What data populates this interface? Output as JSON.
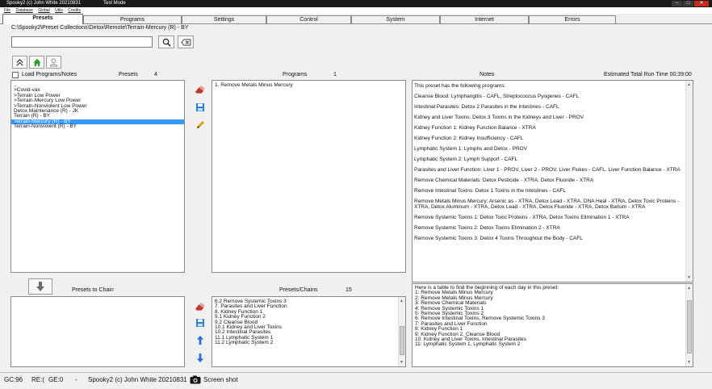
{
  "window": {
    "title": "Spooky2 (c) John White 20210831",
    "mode": "Test Mode"
  },
  "menu": [
    "File",
    "Database",
    "Global",
    "Utils",
    "Credits"
  ],
  "tabs": [
    "Presets",
    "Programs",
    "Settings",
    "Control",
    "System",
    "Internet",
    "Errors"
  ],
  "path": "C:\\Spooky2\\Preset Collections\\Detox\\Remote\\Terrain-Mercury (R) - BY",
  "search": {
    "value": "",
    "placeholder": ""
  },
  "presets": {
    "load_label": "Load Programs/Notes",
    "header": "Presets",
    "count": "4",
    "items": [
      "..",
      ">Covid-vax",
      ">Terrain Low Power",
      ">Terrain-Mercury Low Power",
      ">Terrain-Nonviolent Low Power",
      "Detox Maintenance (R) - JK",
      "Terrain (R) - BY",
      "Terrain-Mercury (R) - BY",
      "Terrain-Nonviolent (R) - BY"
    ],
    "selected_index": 7
  },
  "programs": {
    "header": "Programs",
    "count": "1",
    "items": [
      "1. Remove Metals Minus Mercury"
    ]
  },
  "notes": {
    "header": "Notes",
    "run_time": "Estimated Total Run Time 00:39:00",
    "paragraphs": [
      "This preset has the following programs:",
      "Cleanse Blood: Lymphangitis - CAFL, Streptococcus Pyogenes - CAFL",
      "Intestinal Parasites: Detox 2 Parasites in the Intestines - CAFL",
      "Kidney and Liver Toxins: Detox 3 Toxins in the Kidneys and Liver - PROV",
      "Kidney Function 1: Kidney Function Balance - XTRA",
      "Kidney Function 2: Kidney Insufficiency - CAFL",
      "Lymphatic System 1: Lymphs and Detox - PROV",
      "Lymphatic System 2: Lymph Support - CAFL",
      "Parasites and Liver Function: Liver 1 - PROV, Liver 2 - PROV, Liver Flukes - CAFL, Liver Function Balance - XTRA",
      "Remove Chemical Materials: Detox Pesticide - XTRA, Detox Fluoride - XTRA",
      "Remove Intestinal Toxins: Detox 1 Toxins in the Intestines - CAFL",
      "Remove Metals Minus Mercury: Arsenic as - XTRA, Detox Lead - XTRA, DNA Heal - XTRA, Detox Toxic Proteins - XTRA, Detox Aluminum - XTRA, Detox Lead - XTRA, Detox Fluoride - XTRA, Detox Barium - XTRA",
      "Remove Systemic Toxins 1: Detox Toxic Proteins - XTRA, Detox Toxins Elimination 1 - XTRA",
      "Remove Systemic Toxins 2: Detox Toxins Elimination 2 - XTRA",
      "Remove Systemic Toxins 3: Detox 4 Toxins Throughout the Body - CAFL"
    ]
  },
  "chain": {
    "label": "Presets to Chain",
    "items": []
  },
  "preset_chains": {
    "header": "Presets/Chains",
    "count": "15",
    "items": [
      "6.2 Remove Systemic Toxins 3",
      "7. Parasites and Liver Function",
      "8. Kidney Function 1",
      "9.1 Kidney Function 2",
      "9.2 Cleanse Blood",
      "10.1 Kidney and Liver Toxins",
      "10.2 Intestinal Parasites",
      "11.1 Lymphatic System 1",
      "11.2 Lymphatic System 2"
    ]
  },
  "chain_notes": {
    "lines": [
      "Here is a table to find the beginning of each day in this preset:",
      "1: Remove Metals Minus Mercury",
      "2: Remove Metals Minus Mercury",
      "3: Remove Chemical Materials",
      "4: Remove Systemic Toxins 1",
      "5: Remove Systemic Toxins 2",
      "6: Remove Intestinal Toxins, Remove Systemic Toxins 3",
      "7: Parasites and Liver Function",
      "8: Kidney Function 1",
      "9: Kidney Function 2, Cleanse Blood",
      "10: Kidney and Liver Toxins, Intestinal Parasites",
      "11: Lymphatic System 1, Lymphatic System 2"
    ]
  },
  "status": {
    "gc": "GC:96",
    "re": "RE:(",
    "ge": "GE:0",
    "dash": "-",
    "app": "Spooky2 (c) John White 20210831",
    "screenshot": "Screen shot"
  },
  "colors": {
    "selection": "#3399ff",
    "home_icon": "#2e9b2e",
    "arrow_icon": "#2a6fd6",
    "delete_icon": "#c0392b",
    "edit_icon": "#e0a000",
    "save_icon": "#2a7fd6"
  }
}
